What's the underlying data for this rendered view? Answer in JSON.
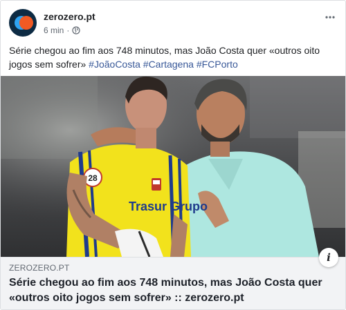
{
  "header": {
    "page_name": "zerozero.pt",
    "time": "6 min",
    "separator": "·"
  },
  "post": {
    "text": "Série chegou ao fim aos 748 minutos, mas João Costa quer «outros oito jogos sem sofrer»",
    "hashtags": [
      "#JoãoCosta",
      "#Cartagena",
      "#FCPorto"
    ]
  },
  "photo": {
    "description": "Goalkeeper in yellow jersey with coach in light blue shirt",
    "jersey_number": "28",
    "jersey_text": "Trasur Grupo"
  },
  "link_preview": {
    "domain": "ZEROZERO.PT",
    "title": "Série chegou ao fim aos 748 minutos, mas João Costa quer «outros oito jogos sem sofrer» :: zerozero.pt",
    "info_icon_label": "i"
  },
  "colors": {
    "hashtag": "#385898",
    "meta": "#606770",
    "link_bg": "#f2f3f5",
    "jersey": "#f2e21c",
    "shirt": "#aee7e0"
  }
}
